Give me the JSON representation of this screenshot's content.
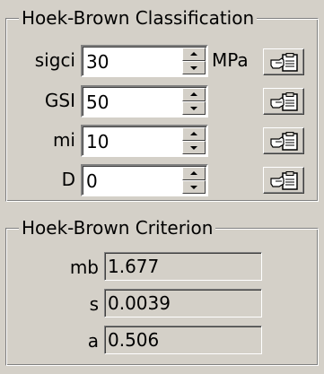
{
  "classification": {
    "title": "Hoek-Brown Classification",
    "rows": [
      {
        "label": "sigci",
        "value": "30",
        "unit": "MPa"
      },
      {
        "label": "GSI",
        "value": "50",
        "unit": ""
      },
      {
        "label": "mi",
        "value": "10",
        "unit": ""
      },
      {
        "label": "D",
        "value": "0",
        "unit": ""
      }
    ],
    "pick_icon": "clipboard-hand-icon"
  },
  "criterion": {
    "title": "Hoek-Brown Criterion",
    "rows": [
      {
        "label": "mb",
        "value": "1.677"
      },
      {
        "label": "s",
        "value": "0.0039"
      },
      {
        "label": "a",
        "value": "0.506"
      }
    ]
  }
}
